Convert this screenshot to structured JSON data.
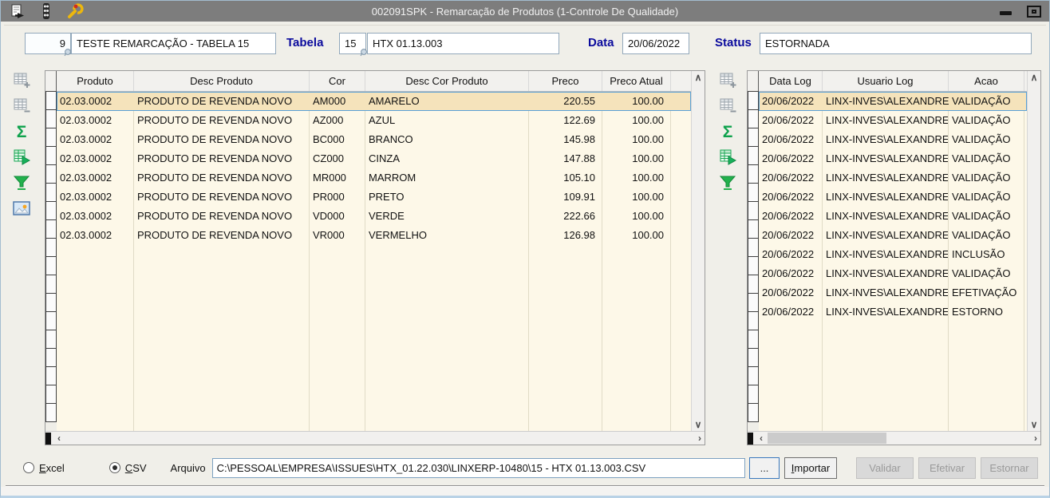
{
  "window": {
    "title": "002091SPK - Remarcação de Produtos (1-Controle De Qualidade)",
    "titlebar_icons": [
      "export-report-icon",
      "traffic-light-icon",
      "wrench-icon"
    ],
    "window_buttons": [
      "minimize",
      "restore"
    ]
  },
  "header_form": {
    "code": "9",
    "name": "TESTE REMARCAÇÃO - TABELA 15",
    "tabela_label": "Tabela",
    "tabela_value": "15",
    "tabela_desc": "HTX 01.13.003",
    "data_label": "Data",
    "data_value": "20/06/2022",
    "status_label": "Status",
    "status_value": "ESTORNADA"
  },
  "toolbars": {
    "left_icons": [
      "add-row-icon",
      "delete-row-icon",
      "sum-icon",
      "export-grid-icon",
      "filter-icon",
      "image-icon"
    ],
    "right_icons": [
      "add-row-icon",
      "delete-row-icon",
      "sum-icon",
      "export-grid-icon",
      "filter-icon"
    ],
    "sum_glyph": "Σ"
  },
  "products_grid": {
    "columns": [
      "Produto",
      "Desc Produto",
      "Cor",
      "Desc Cor Produto",
      "Preco",
      "Preco Atual"
    ],
    "selected_row": 0,
    "rows": [
      [
        "02.03.0002",
        "PRODUTO DE REVENDA NOVO",
        "AM000",
        "AMARELO",
        "220.55",
        "100.00"
      ],
      [
        "02.03.0002",
        "PRODUTO DE REVENDA NOVO",
        "AZ000",
        "AZUL",
        "122.69",
        "100.00"
      ],
      [
        "02.03.0002",
        "PRODUTO DE REVENDA NOVO",
        "BC000",
        "BRANCO",
        "145.98",
        "100.00"
      ],
      [
        "02.03.0002",
        "PRODUTO DE REVENDA NOVO",
        "CZ000",
        "CINZA",
        "147.88",
        "100.00"
      ],
      [
        "02.03.0002",
        "PRODUTO DE REVENDA NOVO",
        "MR000",
        "MARROM",
        "105.10",
        "100.00"
      ],
      [
        "02.03.0002",
        "PRODUTO DE REVENDA NOVO",
        "PR000",
        "PRETO",
        "109.91",
        "100.00"
      ],
      [
        "02.03.0002",
        "PRODUTO DE REVENDA NOVO",
        "VD000",
        "VERDE",
        "222.66",
        "100.00"
      ],
      [
        "02.03.0002",
        "PRODUTO DE REVENDA NOVO",
        "VR000",
        "VERMELHO",
        "126.98",
        "100.00"
      ]
    ]
  },
  "log_grid": {
    "columns": [
      "Data Log",
      "Usuario Log",
      "Acao"
    ],
    "selected_row": 0,
    "rows": [
      [
        "20/06/2022",
        "LINX-INVES\\ALEXANDRE.C",
        "VALIDAÇÃO"
      ],
      [
        "20/06/2022",
        "LINX-INVES\\ALEXANDRE.C",
        "VALIDAÇÃO"
      ],
      [
        "20/06/2022",
        "LINX-INVES\\ALEXANDRE.C",
        "VALIDAÇÃO"
      ],
      [
        "20/06/2022",
        "LINX-INVES\\ALEXANDRE.C",
        "VALIDAÇÃO"
      ],
      [
        "20/06/2022",
        "LINX-INVES\\ALEXANDRE.C",
        "VALIDAÇÃO"
      ],
      [
        "20/06/2022",
        "LINX-INVES\\ALEXANDRE.C",
        "VALIDAÇÃO"
      ],
      [
        "20/06/2022",
        "LINX-INVES\\ALEXANDRE.C",
        "VALIDAÇÃO"
      ],
      [
        "20/06/2022",
        "LINX-INVES\\ALEXANDRE.C",
        "VALIDAÇÃO"
      ],
      [
        "20/06/2022",
        "LINX-INVES\\ALEXANDRE.C",
        "INCLUSÃO"
      ],
      [
        "20/06/2022",
        "LINX-INVES\\ALEXANDRE.C",
        "VALIDAÇÃO"
      ],
      [
        "20/06/2022",
        "LINX-INVES\\ALEXANDRE.C",
        "EFETIVAÇÃO"
      ],
      [
        "20/06/2022",
        "LINX-INVES\\ALEXANDRE.C",
        "ESTORNO"
      ]
    ]
  },
  "footer": {
    "excel_label": "Excel",
    "csv_label": "CSV",
    "selected_format": "CSV",
    "arquivo_label": "Arquivo",
    "arquivo_value": "C:\\PESSOAL\\EMPRESA\\ISSUES\\HTX_01.22.030\\LINXERP-10480\\15 - HTX 01.13.003.CSV",
    "browse_label": "...",
    "importar_label": "Importar",
    "validar_label": "Validar",
    "efetivar_label": "Efetivar",
    "estornar_label": "Estornar"
  },
  "colors": {
    "titlebar": "#7d7d7d",
    "window_bg": "#f0efe9",
    "grid_row_bg": "#fdf8e8",
    "selected_row_bg": "#f5e3bb",
    "selection_border": "#58a0d8",
    "label_blue": "#0b0b9d",
    "icon_green": "#0fa24d"
  }
}
